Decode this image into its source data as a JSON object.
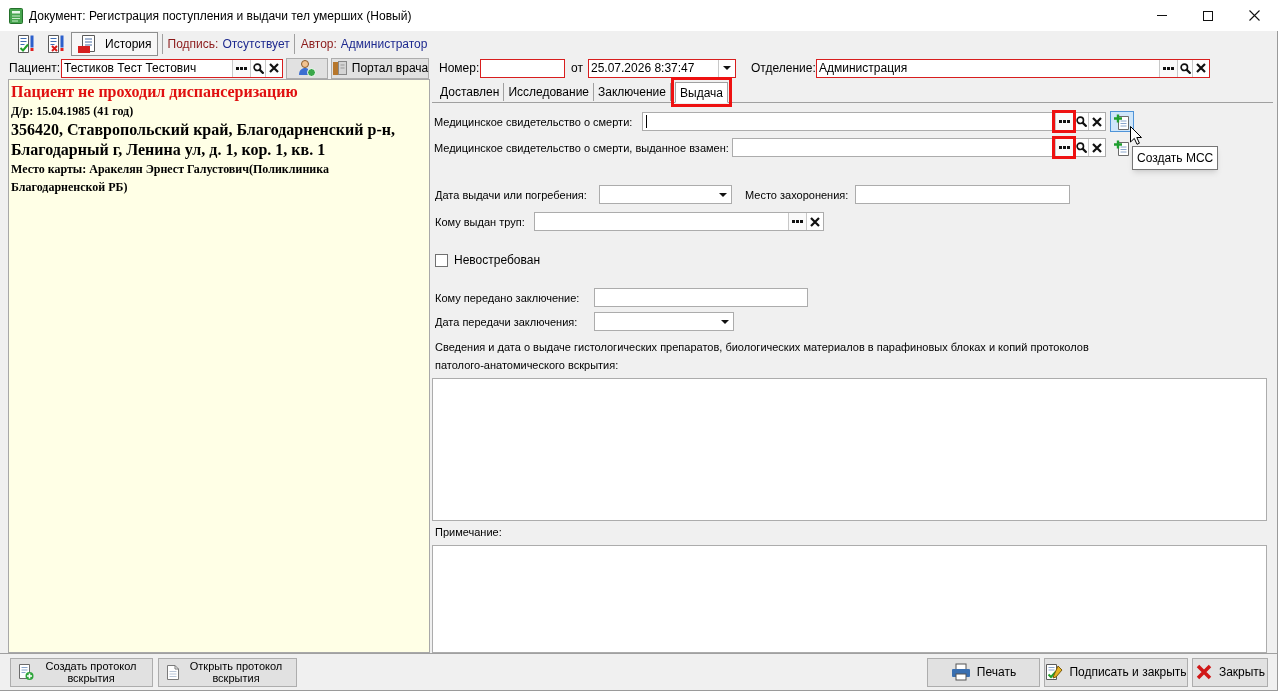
{
  "window": {
    "title": "Документ: Регистрация поступления и выдачи тел умерших (Новый)"
  },
  "toolbar": {
    "history_button": {
      "label": "История",
      "pressed": true
    },
    "signature": {
      "label": "Подпись:",
      "value": "Отсутствует"
    },
    "author": {
      "label": "Автор:",
      "value": "Администратор"
    }
  },
  "header": {
    "patient": {
      "label": "Пациент:",
      "value": "Тестиков Тест Тестович",
      "required": true
    },
    "portal_button": {
      "label": "Портал врача"
    },
    "number": {
      "label": "Номер:",
      "required": true
    },
    "date": {
      "label": "от",
      "value": "25.07.2026 8:37:47",
      "required": true
    },
    "department": {
      "label": "Отделение:",
      "value": "Администрация",
      "required": true
    }
  },
  "patient_info": [
    {
      "kind": "alert",
      "text": "Пациент не проходил диспансеризацию"
    },
    {
      "kind": "detail",
      "text": "Д/р: 15.04.1985 (41 год)"
    },
    {
      "kind": "address",
      "text": "356420, Ставропольский край, Благодарненский р-н, Благодарный г, Ленина ул, д. 1, кор. 1, кв. 1"
    },
    {
      "kind": "detail",
      "text": "Место карты: Аракелян Эрнест Галустович(Поликлиника Благодарненской РБ)"
    }
  ],
  "tabs": [
    {
      "label": "Доставлен",
      "selected": false,
      "highlighted": false
    },
    {
      "label": "Исследование",
      "selected": false,
      "highlighted": false
    },
    {
      "label": "Заключение",
      "selected": false,
      "highlighted": false
    },
    {
      "label": "Выдача",
      "selected": true,
      "highlighted": true
    }
  ],
  "certificates": [
    {
      "label": "Медицинское свидетельство о смерти:",
      "focused": true,
      "dots_highlighted": true,
      "add_hovered": true
    },
    {
      "label": "Медицинское свидетельство о смерти, выданное взамен:",
      "focused": false,
      "dots_highlighted": true,
      "add_hovered": false
    }
  ],
  "tooltip": {
    "text": "Создать МСС"
  },
  "burial": {
    "date_label": "Дата выдачи или погребения:",
    "place_label": "Место захоронения:"
  },
  "body_recipient": {
    "label": "Кому выдан труп:"
  },
  "unclaimed": {
    "label": "Невостребован",
    "checked": false
  },
  "conclusion": {
    "recipient_label": "Кому передано заключение:",
    "date_label": "Дата передачи заключения:"
  },
  "materials": {
    "label": "Сведения и дата о выдаче гистологических препаратов, биологических материалов в парафиновых блоках и копий протоколов патолого-анатомического вскрытия:"
  },
  "note": {
    "label": "Примечание:"
  },
  "footer": {
    "left_buttons": [
      {
        "kind": "create",
        "label": "Создать протокол вскрытия"
      },
      {
        "kind": "open",
        "label": "Открыть протокол вскрытия"
      }
    ],
    "right_buttons": [
      {
        "kind": "print",
        "label": "Печать"
      },
      {
        "kind": "sign",
        "label": "Подписать и закрыть"
      },
      {
        "kind": "close",
        "label": "Закрыть"
      }
    ]
  }
}
